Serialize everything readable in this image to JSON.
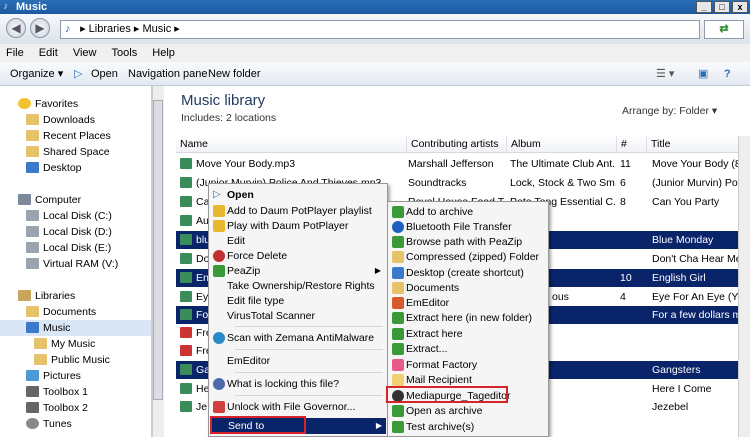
{
  "window": {
    "title": "Music"
  },
  "address": {
    "path": [
      "Libraries",
      "Music"
    ]
  },
  "menubar": [
    "File",
    "Edit",
    "View",
    "Tools",
    "Help"
  ],
  "toolbar": {
    "organize": "Organize",
    "open": "Open",
    "navpane": "Navigation pane",
    "newfolder": "New folder"
  },
  "sidebar": {
    "favorites": "Favorites",
    "downloads": "Downloads",
    "recent": "Recent Places",
    "shared": "Shared Space",
    "desktop": "Desktop",
    "computer": "Computer",
    "diskc": "Local Disk (C:)",
    "diskd": "Local Disk (D:)",
    "diske": "Local Disk (E:)",
    "vram": "Virtual RAM (V:)",
    "libraries": "Libraries",
    "documents": "Documents",
    "music": "Music",
    "mymusic": "My Music",
    "publicmusic": "Public Music",
    "pictures": "Pictures",
    "toolbox1": "Toolbox 1",
    "toolbox2": "Toolbox 2",
    "tunes": "Tunes"
  },
  "library": {
    "title": "Music library",
    "includes": "Includes:",
    "locations": "2 locations",
    "arrange_label": "Arrange by:",
    "arrange_value": "Folder"
  },
  "columns": {
    "name": "Name",
    "artist": "Contributing artists",
    "album": "Album",
    "num": "#",
    "title": "Title"
  },
  "rows": [
    {
      "name": "Move Your Body.mp3",
      "artist": "Marshall Jefferson",
      "album": "The Ultimate Club Ant...",
      "num": "11",
      "title": "Move Your Body (89"
    },
    {
      "name": "(Junior Murvin) Police And Thieves.mp3",
      "artist": "Soundtracks",
      "album": "Lock, Stock & Two Sm...",
      "num": "6",
      "title": "(Junior Murvin) Po"
    },
    {
      "name": "Ca",
      "artist": "Ravel House Food T...",
      "album": "Pete Tong Essential C...",
      "num": "8",
      "title": "Can You Party"
    },
    {
      "name": "Au",
      "artist": "",
      "album": "",
      "num": "",
      "title": ""
    },
    {
      "name": "blu",
      "artist": "",
      "album": "",
      "num": "",
      "title": "Blue Monday"
    },
    {
      "name": "Do",
      "artist": "",
      "album": "",
      "num": "",
      "title": "Don't Cha Hear Me C"
    },
    {
      "name": "En",
      "artist": "",
      "album": "",
      "num": "10",
      "title": "English Girl"
    },
    {
      "name": "Ey",
      "artist": "",
      "album": "ous",
      "num": "4",
      "title": "Eye For An Eye (You"
    },
    {
      "name": "Fo",
      "artist": "",
      "album": "",
      "num": "",
      "title": "For a few dollars mo"
    },
    {
      "name": "Fre",
      "artist": "",
      "album": "",
      "num": "",
      "title": ""
    },
    {
      "name": "Fre",
      "artist": "",
      "album": "",
      "num": "",
      "title": ""
    },
    {
      "name": "Ga",
      "artist": "",
      "album": "",
      "num": "",
      "title": "Gangsters"
    },
    {
      "name": "He",
      "artist": "",
      "album": "",
      "num": "",
      "title": "Here I Come"
    },
    {
      "name": "Je",
      "artist": "",
      "album": "",
      "num": "",
      "title": "Jezebel"
    }
  ],
  "context_menu": {
    "open": "Open",
    "add_daum": "Add to Daum PotPlayer playlist",
    "play_daum": "Play with Daum PotPlayer",
    "edit": "Edit",
    "force_delete": "Force Delete",
    "peazip": "PeaZip",
    "take_ownership": "Take Ownership/Restore Rights",
    "edit_filetype": "Edit file type",
    "virustotal": "VirusTotal Scanner",
    "zemana": "Scan with Zemana AntiMalware",
    "emeditor": "EmEditor",
    "locking": "What is locking this file?",
    "unlock": "Unlock with File Governor...",
    "sendto": "Send to"
  },
  "submenu": {
    "add_archive": "Add to archive",
    "bluetooth": "Bluetooth File Transfer",
    "browse_peazip": "Browse path with PeaZip",
    "compressed": "Compressed (zipped) Folder",
    "desktop_shortcut": "Desktop (create shortcut)",
    "documents": "Documents",
    "emeditor": "EmEditor",
    "extract_new": "Extract here (in new folder)",
    "extract_here": "Extract here",
    "extract": "Extract...",
    "format_factory": "Format Factory",
    "mail": "Mail Recipient",
    "mediapurge": "Mediapurge_Tageditor",
    "open_archive": "Open as archive",
    "test_archive": "Test archive(s)"
  }
}
